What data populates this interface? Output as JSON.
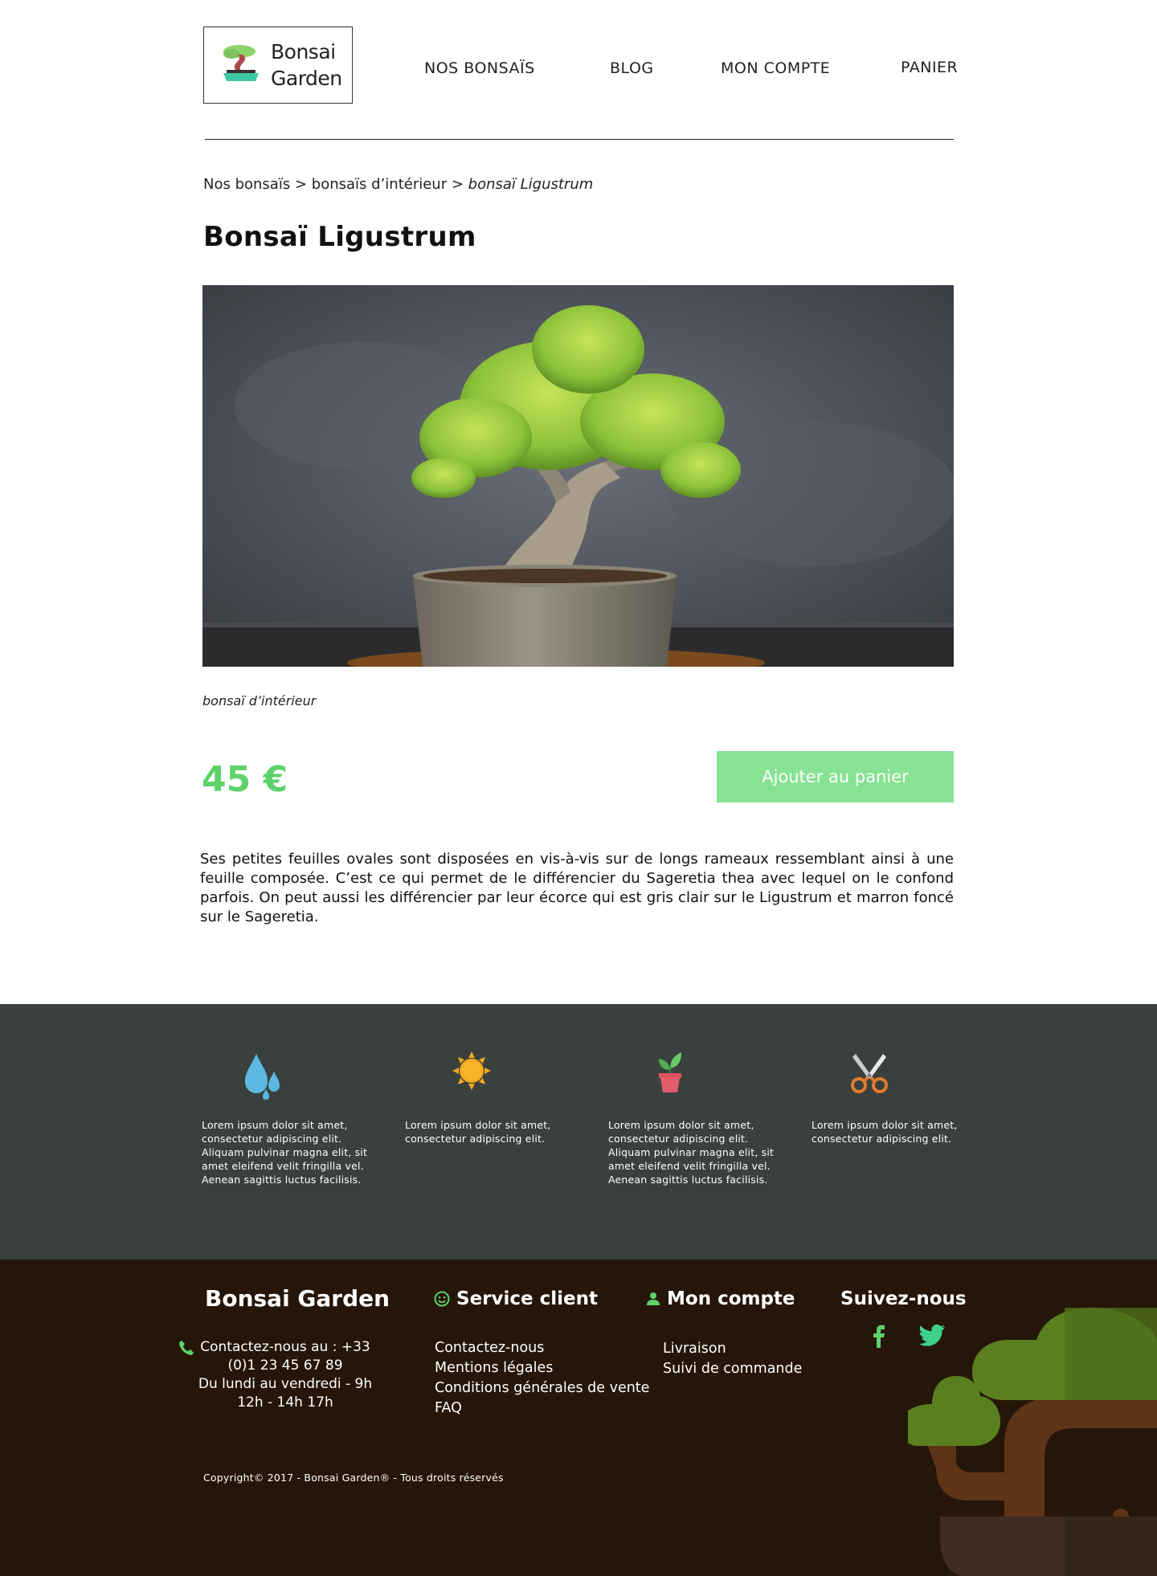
{
  "header": {
    "logo_text_line1": "Bonsai",
    "logo_text_line2": "Garden",
    "nav": [
      "NOS BONSAÏS",
      "BLOG",
      "MON COMPTE",
      "PANIER"
    ]
  },
  "breadcrumb": {
    "items": [
      "Nos bonsaïs",
      "bonsaïs d’intérieur",
      "bonsaï Ligustrum"
    ],
    "separator": ">"
  },
  "product": {
    "title": "Bonsaï Ligustrum",
    "category": "bonsaï d’intérieur",
    "price": "45 €",
    "add_to_cart_label": "Ajouter au panier",
    "description": "Ses petites feuilles ovales sont disposées en vis-à-vis sur de longs rameaux ressemblant ainsi à une feuille composée. C’est ce qui permet de le différencier du Sageretia thea avec lequel on le confond parfois. On peut aussi les différencier par leur écorce qui est gris clair sur le Ligustrum et marron foncé sur le Sageretia."
  },
  "care": [
    {
      "icon": "water-drops-icon",
      "text": "Lorem ipsum dolor sit amet, consectetur adipiscing elit. Aliquam pulvinar magna elit, sit amet eleifend velit fringilla vel. Aenean sagittis luctus facilisis."
    },
    {
      "icon": "sun-icon",
      "text": "Lorem ipsum dolor sit amet, consectetur adipiscing elit."
    },
    {
      "icon": "potted-plant-icon",
      "text": "Lorem ipsum dolor sit amet, consectetur adipiscing elit. Aliquam pulvinar magna elit, sit amet eleifend velit fringilla vel. Aenean sagittis luctus facilisis."
    },
    {
      "icon": "scissors-icon",
      "text": "Lorem ipsum dolor sit amet, consectetur adipiscing elit."
    }
  ],
  "footer": {
    "brand": "Bonsai Garden",
    "contact_lines": [
      "Contactez-nous au : +33",
      "(0)1 23 45 67 89",
      "Du lundi au vendredi - 9h",
      "12h - 14h 17h"
    ],
    "service": {
      "heading": "Service client",
      "links": [
        "Contactez-nous",
        "Mentions légales",
        "Conditions générales de vente",
        "FAQ"
      ]
    },
    "account": {
      "heading": "Mon compte",
      "links": [
        "Livraison",
        "Suivi de commande"
      ]
    },
    "follow": {
      "heading": "Suivez-nous"
    },
    "copyright": "Copyright© 2017 - Bonsai Garden® - Tous droits réservés"
  },
  "colors": {
    "accent_green": "#5ed26a",
    "button_green": "#87e293",
    "care_band_bg": "#3a403d",
    "footer_bg": "#251609"
  }
}
